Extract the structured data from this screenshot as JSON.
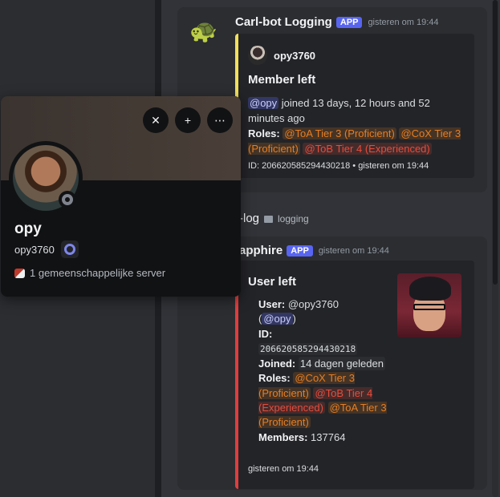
{
  "message1": {
    "author": "Carl-bot Logging",
    "app_tag": "APP",
    "timestamp": "gisteren om 19:44",
    "embed": {
      "author": "opy3760",
      "title": "Member left",
      "mention": "@opy",
      "joined_text": " joined 13 days, 12 hours and 52 minutes ago",
      "roles_label": "Roles:",
      "roles": [
        "@ToA Tier 3 (Proficient)",
        "@CoX Tier 3 (Proficient)",
        "@ToB Tier 4 (Experienced)"
      ],
      "footer": "ID: 206620585294430218 • gisteren om 19:44",
      "bar_color": "#f1e05a"
    }
  },
  "channel": {
    "name": "-log",
    "category": "logging"
  },
  "message2": {
    "author": "apphire",
    "app_tag": "APP",
    "timestamp": "gisteren om 19:44",
    "embed": {
      "title": "User left",
      "user_label": "User:",
      "user_value": " @opy3760",
      "user_mention": "@opy",
      "id_label": "ID:",
      "id_value": "206620585294430218",
      "joined_label": "Joined:",
      "joined_value": "14 dagen geleden",
      "roles_label": "Roles:",
      "roles": [
        "@CoX Tier 3 (Proficient)",
        "@ToB Tier 4 (Experienced)",
        "@ToA Tier 3 (Proficient)"
      ],
      "members_label": "Members:",
      "members_value": "137764",
      "footer": "gisteren om 19:44",
      "bar_color": "#e03e3e"
    }
  },
  "profile": {
    "display_name": "opy",
    "username": "opy3760",
    "mutual_servers": "1 gemeenschappelijke server",
    "buttons": [
      "block-icon",
      "add-friend-icon",
      "more-icon"
    ],
    "status": "offline"
  },
  "colors": {
    "accent": "#5865f2",
    "role_orange": "#e67e22",
    "role_red": "#e74c3c"
  }
}
